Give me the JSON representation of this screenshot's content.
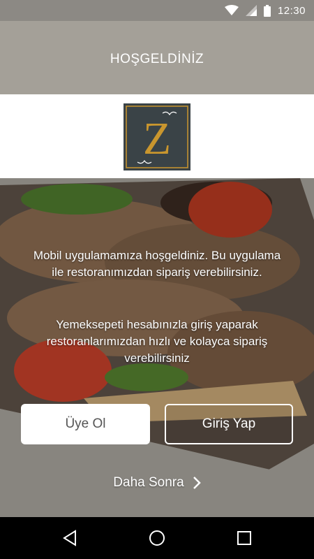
{
  "status_bar": {
    "time": "12:30",
    "icons": [
      "wifi-icon",
      "signal-icon",
      "battery-icon"
    ]
  },
  "header": {
    "title": "HOŞGELDİNİZ"
  },
  "logo": {
    "letter": "Z",
    "bg_color": "#3a4347",
    "accent_color": "#c9962e"
  },
  "intro": {
    "paragraph_1": "Mobil uygulamamıza hoşgeldiniz. Bu uygulama ile restoranımızdan sipariş verebilirsiniz.",
    "paragraph_2": "Yemeksepeti hesabınızla giriş yaparak restoranlarımızdan hızlı ve kolayca sipariş verebilirsiniz"
  },
  "buttons": {
    "register": "Üye Ol",
    "login": "Giriş Yap"
  },
  "later": {
    "label": "Daha Sonra",
    "icon": "chevron-right-icon"
  },
  "nav_bar": {
    "buttons": [
      "back-icon",
      "home-icon",
      "recents-icon"
    ]
  }
}
